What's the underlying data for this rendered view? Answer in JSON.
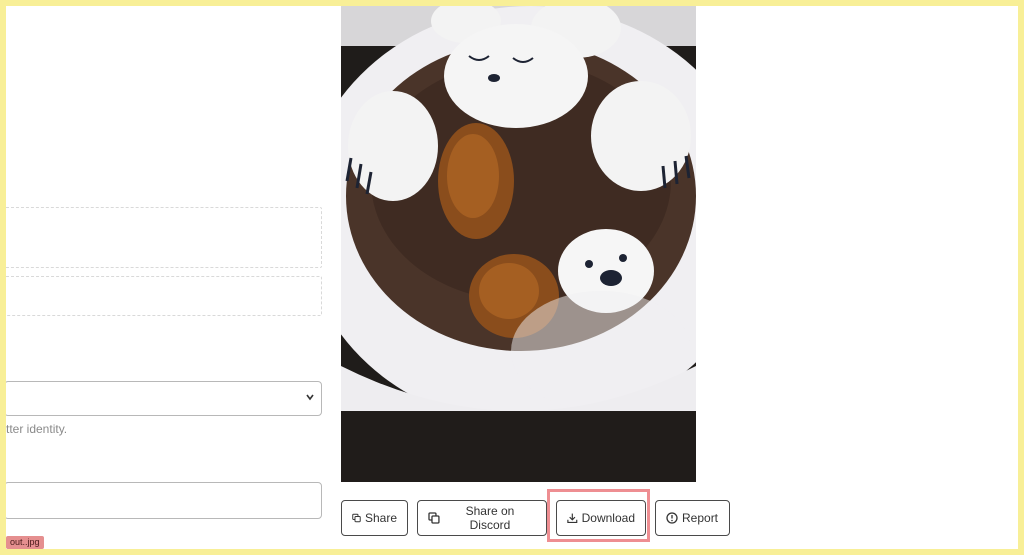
{
  "form": {
    "helper_text": "tter identity.",
    "select_value": "",
    "input_value": "",
    "file_chip": "out..jpg"
  },
  "image": {
    "alt": "Curry rice with bear-shaped rice"
  },
  "toolbar": {
    "share_label": "Share",
    "discord_label": "Share on Discord",
    "download_label": "Download",
    "report_label": "Report"
  },
  "colors": {
    "highlight": "#ee8e92",
    "outer_frame": "#f8ef97"
  },
  "icons": {
    "share": "copy-icon",
    "discord": "copy-icon",
    "download": "download-icon",
    "report": "info-circle-icon",
    "select": "chevron-down-icon"
  }
}
